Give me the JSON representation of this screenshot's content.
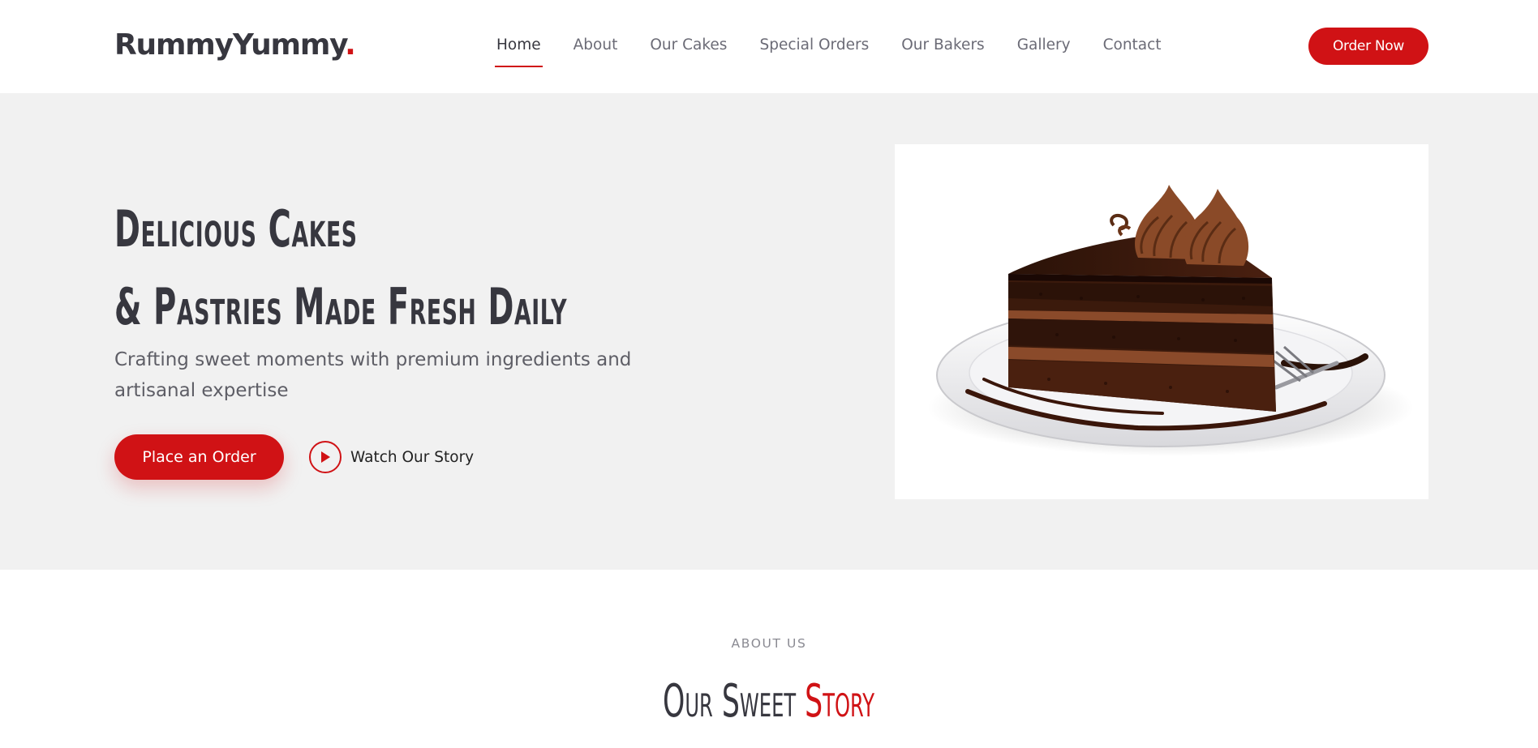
{
  "brand": {
    "name": "RummyYummy",
    "dot": "."
  },
  "nav": {
    "items": [
      {
        "label": "Home",
        "active": true
      },
      {
        "label": "About"
      },
      {
        "label": "Our Cakes"
      },
      {
        "label": "Special Orders"
      },
      {
        "label": "Our Bakers"
      },
      {
        "label": "Gallery"
      },
      {
        "label": "Contact"
      }
    ],
    "cta": "Order Now"
  },
  "hero": {
    "title_line1": "Delicious Cakes",
    "title_line2": "& Pastries Made Fresh Daily",
    "subtitle": "Crafting sweet moments with premium ingredients and artisanal expertise",
    "primary_button": "Place an Order",
    "secondary_button": "Watch Our Story",
    "image_icon": "chocolate-cake-slice-image"
  },
  "about": {
    "kicker": "ABOUT US",
    "heading_part1": "Our Sweet ",
    "heading_part2": "Story"
  },
  "colors": {
    "accent": "#d01215",
    "text_dark": "#37373f",
    "text_muted": "#6b6b76",
    "hero_bg": "#f1f1f1"
  }
}
